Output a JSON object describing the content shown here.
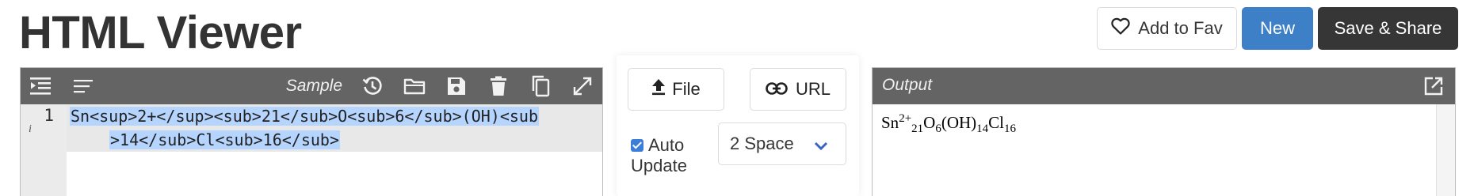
{
  "page": {
    "title": "HTML Viewer"
  },
  "actions": {
    "fav_label": "Add to Fav",
    "new_label": "New",
    "save_label": "Save & Share"
  },
  "editor": {
    "sample_label": "Sample",
    "line_number": "1",
    "line_info": "i",
    "code_line1": "Sn<sup>2+</sup><sub>21</sub>O<sub>6</sub>(OH)<sub",
    "code_line2": ">14</sub>Cl<sub>16</sub>"
  },
  "middle": {
    "file_label": "File",
    "url_label": "URL",
    "auto_update_label": "Auto Update",
    "auto_update_checked": true,
    "indent_selected": "2 Space"
  },
  "output": {
    "label": "Output",
    "formula": {
      "sn": "Sn",
      "sup1": "2+",
      "sub1": "21",
      "o": "O",
      "sub2": "6",
      "oh": "(OH)",
      "sub3": "14",
      "cl": "Cl",
      "sub4": "16"
    }
  },
  "colors": {
    "primary": "#3e80c8",
    "dark": "#363636",
    "toolbar": "#646464",
    "selection": "#b5d5ff"
  }
}
